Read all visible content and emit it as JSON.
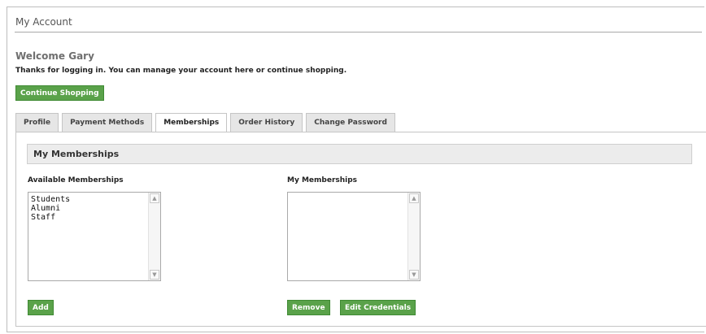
{
  "header": {
    "title": "My Account"
  },
  "welcome": {
    "heading": "Welcome Gary",
    "message": "Thanks for logging in. You can manage your account here or continue shopping.",
    "continue_button": "Continue Shopping"
  },
  "tabs": [
    {
      "label": "Profile",
      "active": false
    },
    {
      "label": "Payment Methods",
      "active": false
    },
    {
      "label": "Memberships",
      "active": true
    },
    {
      "label": "Order History",
      "active": false
    },
    {
      "label": "Change Password",
      "active": false
    }
  ],
  "memberships": {
    "section_title": "My Memberships",
    "available": {
      "label": "Available Memberships",
      "items": [
        "Students",
        "Alumni",
        "Staff"
      ],
      "add_button": "Add"
    },
    "mine": {
      "label": "My Memberships",
      "items": [],
      "remove_button": "Remove",
      "edit_button": "Edit Credentials"
    }
  },
  "colors": {
    "button_green": "#5aa24a",
    "tab_bg": "#e6e6e6",
    "header_bg": "#ececec"
  },
  "icons": {
    "scroll_up": "chevron-up-icon",
    "scroll_down": "chevron-down-icon"
  }
}
